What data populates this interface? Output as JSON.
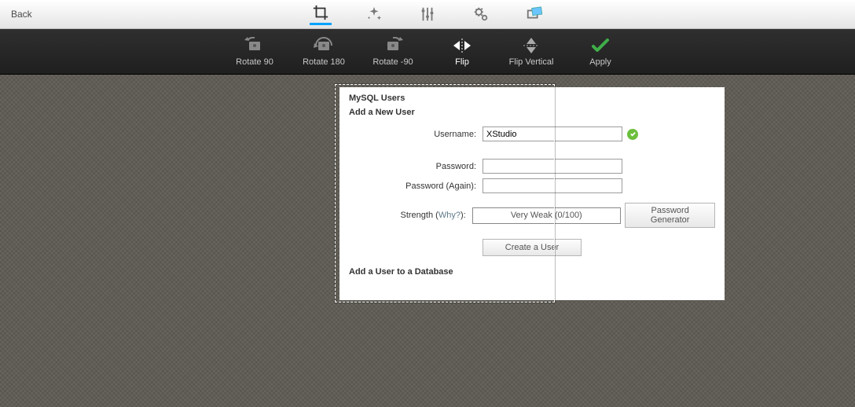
{
  "topbar": {
    "back": "Back",
    "tools": {
      "crop": "crop",
      "sparkle": "auto",
      "sliders": "adjust",
      "gears": "settings",
      "overlay": "overlay"
    }
  },
  "subbar": {
    "rotate90": "Rotate 90",
    "rotate180": "Rotate 180",
    "rotate_neg90": "Rotate -90",
    "flip": "Flip",
    "flip_vertical": "Flip Vertical",
    "apply": "Apply"
  },
  "panel": {
    "title": "MySQL Users",
    "subtitle": "Add a New User",
    "username_label": "Username:",
    "username_value": "XStudio",
    "password_label": "Password:",
    "password_value": "",
    "password2_label": "Password (Again):",
    "password2_value": "",
    "strength_label_pre": "Strength (",
    "strength_why": "Why?",
    "strength_label_post": "):",
    "strength_text": "Very Weak (0/100)",
    "gen_btn": "Password Generator",
    "create_btn": "Create a User",
    "section2": "Add a User to a Database"
  }
}
